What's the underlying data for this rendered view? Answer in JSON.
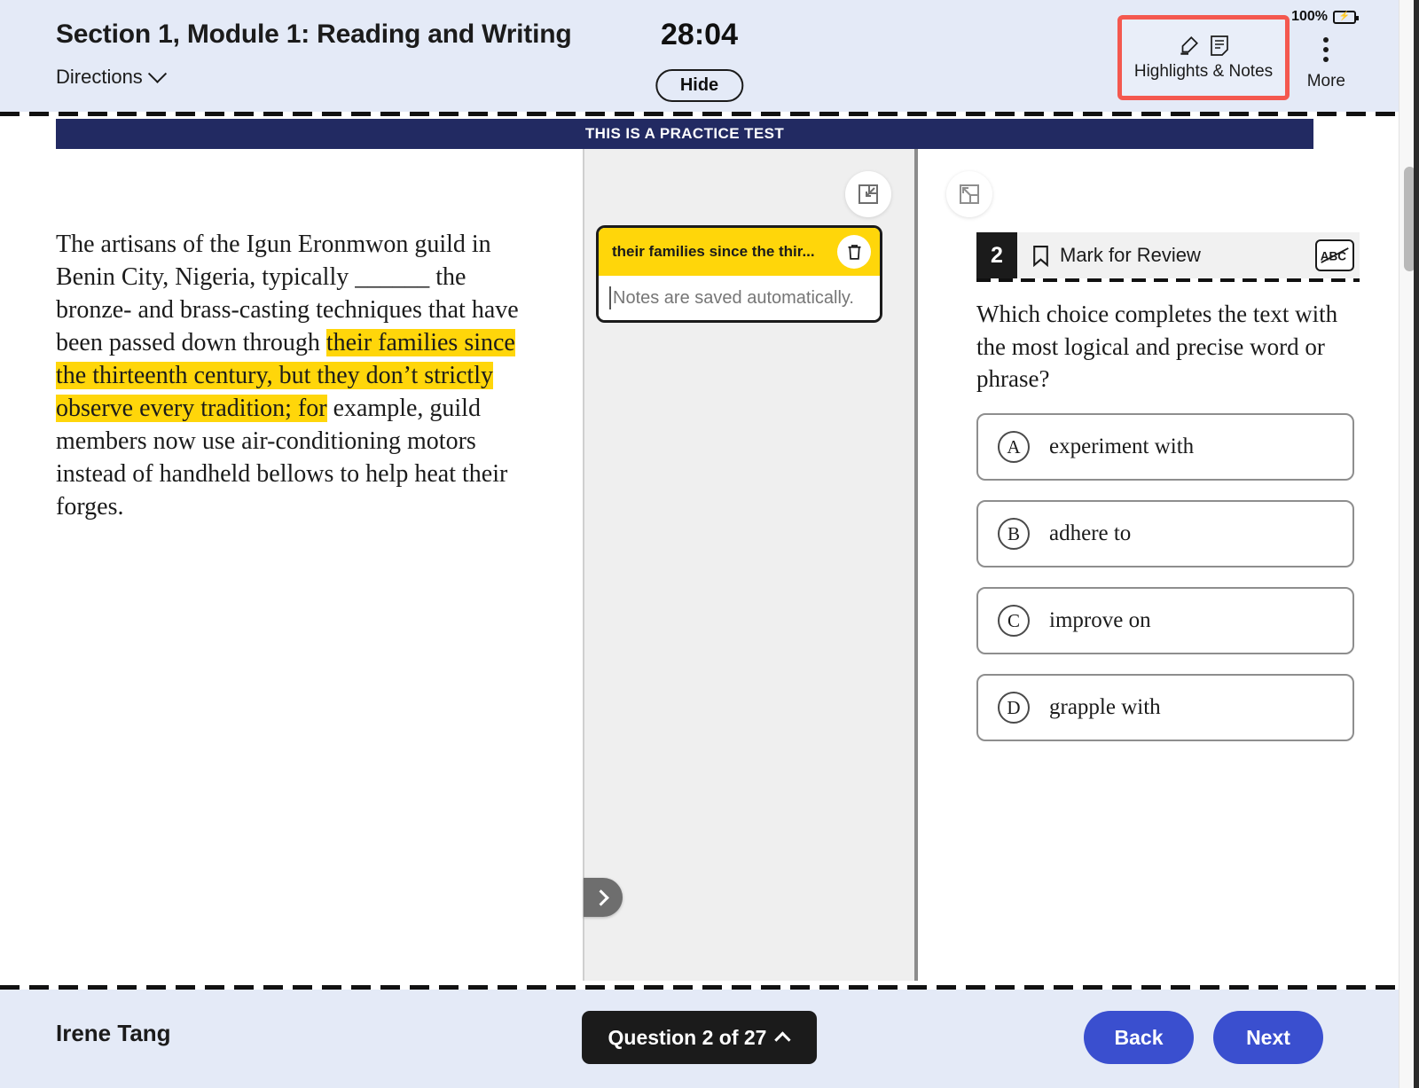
{
  "header": {
    "title": "Section 1, Module 1: Reading and Writing",
    "directions_label": "Directions",
    "directions_icon": "chevron-down-icon",
    "timer": "28:04",
    "hide_label": "Hide",
    "highlights_notes_label": "Highlights & Notes",
    "highlighter_icon": "highlighter-pen-icon",
    "note_icon": "note-page-icon",
    "more_label": "More",
    "more_icon": "vertical-dots-icon",
    "battery_percent": "100%",
    "battery_icon": "battery-charging-icon",
    "highlight_box_color": "#f4584f"
  },
  "banner": {
    "text": "THIS IS A PRACTICE TEST",
    "color": "#222a62"
  },
  "passage": {
    "segments": [
      {
        "text": "The artisans of the Igun Eronmwon guild in Benin City, Nigeria, typically ______ the bronze- and brass-casting techniques that have been passed down through ",
        "highlighted": false
      },
      {
        "text": "their families since the thirteenth century, but they don’t strictly observe every tradition; for",
        "highlighted": true
      },
      {
        "text": " example, guild members now use air-conditioning motors instead of handheld bellows to help heat their forges.",
        "highlighted": false
      }
    ],
    "highlight_color": "#ffd60a"
  },
  "notes_panel": {
    "collapse_icon": "panel-collapse-icon",
    "expand_icon": "chevron-right-icon",
    "note": {
      "title": "their families since the thir...",
      "delete_icon": "trash-icon",
      "placeholder": "Notes are saved automatically.",
      "value": ""
    }
  },
  "question": {
    "collapse_icon": "panel-expand-icon",
    "number": "2",
    "mark_for_review_label": "Mark for Review",
    "bookmark_icon": "bookmark-icon",
    "abc_icon": "abc-strikethrough-icon",
    "prompt": "Which choice completes the text with the most logical and precise word or phrase?",
    "choices": [
      {
        "letter": "A",
        "text": "experiment with"
      },
      {
        "letter": "B",
        "text": "adhere to"
      },
      {
        "letter": "C",
        "text": "improve on"
      },
      {
        "letter": "D",
        "text": "grapple with"
      }
    ]
  },
  "footer": {
    "student_name": "Irene Tang",
    "question_nav_label": "Question 2 of 27",
    "question_nav_icon": "chevron-up-icon",
    "back_label": "Back",
    "next_label": "Next",
    "button_color": "#3a4fcf"
  }
}
